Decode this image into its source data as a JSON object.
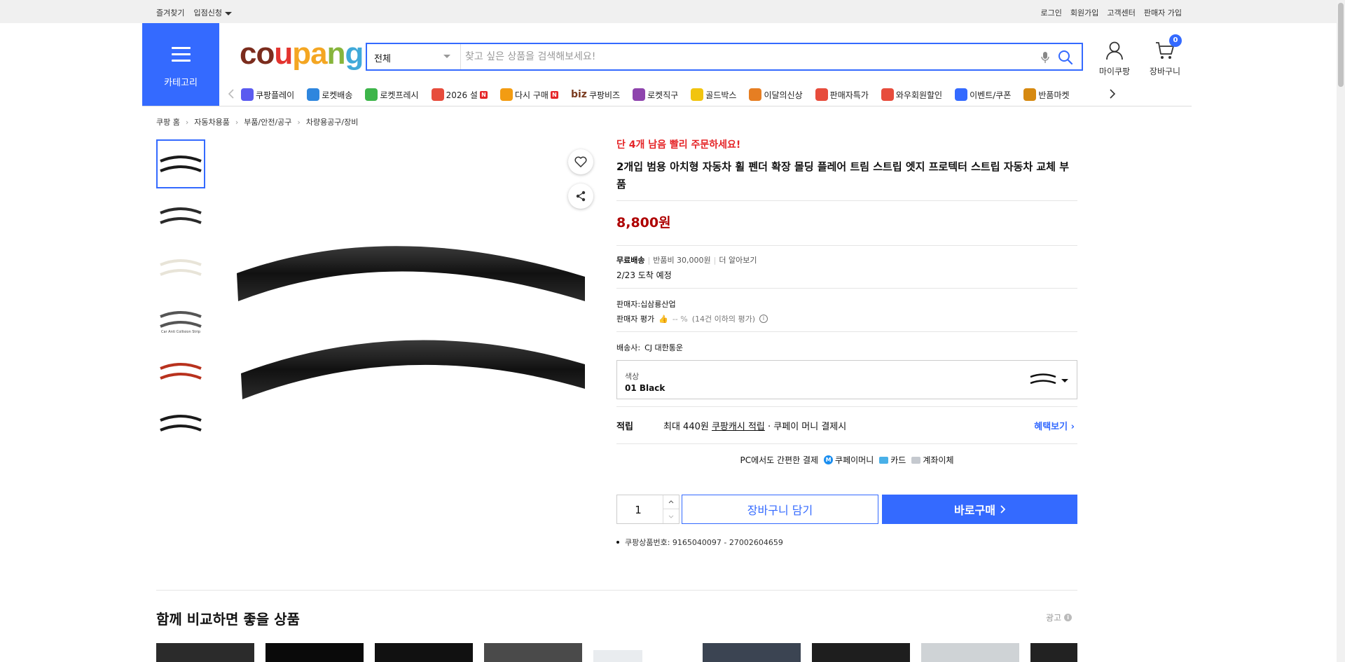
{
  "topbar": {
    "bookmark": "즐겨찾기",
    "seller_apply": "입점신청",
    "login": "로그인",
    "signup": "회원가입",
    "customer_center": "고객센터",
    "seller_signup": "판매자 가입"
  },
  "header": {
    "category_label": "카테고리",
    "logo": {
      "c1": "co",
      "c2": "u",
      "c3": "pa",
      "c4": "n",
      "c5": "g"
    },
    "search_category": "전체",
    "search_placeholder": "찾고 싶은 상품을 검색해보세요!",
    "mypage_label": "마이쿠팡",
    "cart_label": "장바구니",
    "cart_count": "0"
  },
  "nav": {
    "items": [
      {
        "label": "쿠팡플레이",
        "icon": "play-icon",
        "color": "#5b5bf0"
      },
      {
        "label": "로켓배송",
        "icon": "rocket-icon",
        "color": "#2e86de"
      },
      {
        "label": "로켓프레시",
        "icon": "rocket-fresh-icon",
        "color": "#3db54a"
      },
      {
        "label": "2026 설",
        "icon": "gift-icon",
        "color": "#e74c3c",
        "badge": "N"
      },
      {
        "label": "다시 구매",
        "icon": "home-repurchase-icon",
        "color": "#f39c12",
        "badge": "N"
      },
      {
        "label": "쿠팡비즈",
        "icon": "biz-icon",
        "color": "#7a3b1f",
        "prefix": "biz"
      },
      {
        "label": "로켓직구",
        "icon": "rocket-global-icon",
        "color": "#8e44ad"
      },
      {
        "label": "골드박스",
        "icon": "goldbox-icon",
        "color": "#f1c40f"
      },
      {
        "label": "이달의신상",
        "icon": "new-icon",
        "color": "#e67e22"
      },
      {
        "label": "판매자특가",
        "icon": "percent-icon",
        "color": "#e74c3c"
      },
      {
        "label": "와우회원할인",
        "icon": "wow-icon",
        "color": "#e74c3c"
      },
      {
        "label": "이벤트/쿠폰",
        "icon": "coupon-icon",
        "color": "#346aff"
      },
      {
        "label": "반품마켓",
        "icon": "return-market-icon",
        "color": "#d68910"
      }
    ]
  },
  "breadcrumb": [
    "쿠팡 홈",
    "자동차용품",
    "부품/안전/공구",
    "차량용공구/장비"
  ],
  "product": {
    "urgent": "단 4개 남음 빨리 주문하세요!",
    "title": "2개입 범용 아치형 자동차 휠 펜더 확장 몰딩 플레어 트림 스트립 엣지 프로텍터 스트립 자동차 교체 부품",
    "price": "8,800원",
    "shipping": {
      "free": "무료배송",
      "return_fee": "반품비 30,000원",
      "more": "더 알아보기",
      "arrival": "2/23 도착 예정"
    },
    "seller": {
      "name": "판매자:십삼룡산업",
      "rating_label": "판매자 평가",
      "rating_value": "-- %",
      "rating_note": "(14건 이하의 평가)"
    },
    "carrier": {
      "label": "배송사:",
      "name": "CJ 대한통운"
    },
    "option": {
      "label": "색상",
      "value": "01 Black"
    },
    "reward": {
      "label": "적립",
      "text1": "최대 440원",
      "link": "쿠팡캐시 적립",
      "text2": "· 쿠페이 머니 결제시",
      "more": "혜택보기"
    },
    "pay": {
      "label": "PC에서도 간편한 결제",
      "coupay": "쿠페이머니",
      "coupay_icon": "M",
      "card": "카드",
      "account": "계좌이체"
    },
    "quantity": "1",
    "cart_button": "장바구니 담기",
    "buy_button": "바로구매",
    "product_number": "쿠팡상품번호: 9165040097 - 27002604659"
  },
  "thumbnails": [
    {
      "color": "#1a1a1a",
      "active": true
    },
    {
      "color": "#2a2a2a",
      "active": false
    },
    {
      "color": "#e8e4d8",
      "active": false
    },
    {
      "color": "#555555",
      "active": false,
      "caption": "Car Anti Collision Strip"
    },
    {
      "color": "#b8321e",
      "active": false
    },
    {
      "color": "#1a1a1a",
      "active": false
    }
  ],
  "compare": {
    "title": "함께 비교하면 좋을 상품",
    "ad_label": "광고",
    "ad_info": "i"
  },
  "colors": {
    "brand_blue": "#346aff",
    "price_red": "#ae0000",
    "urgent_red": "#e52528"
  }
}
